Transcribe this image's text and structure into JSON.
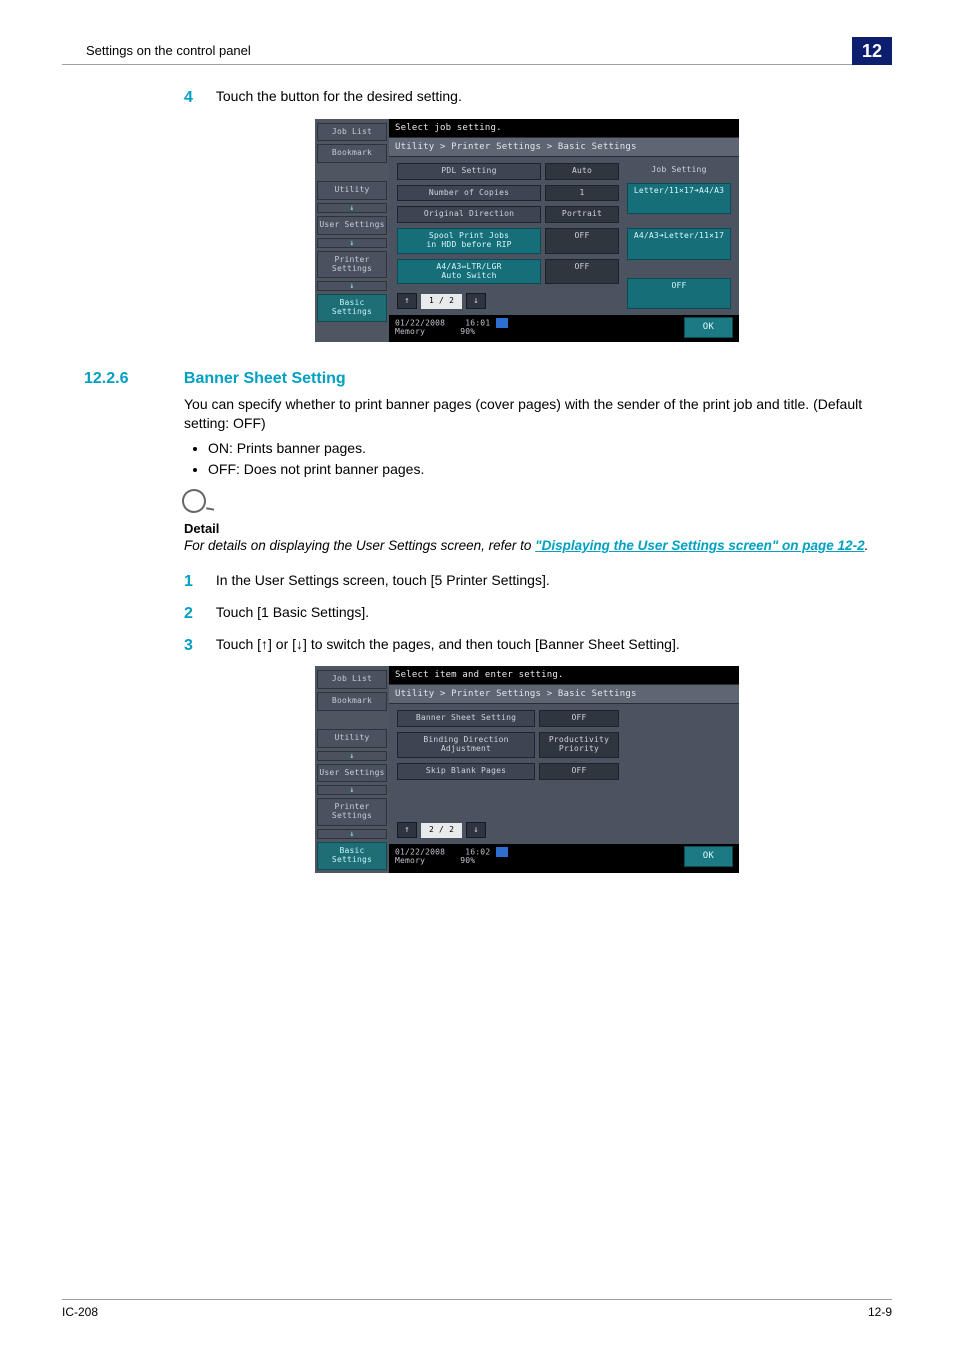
{
  "header": {
    "running_title": "Settings on the control panel",
    "chapter_number": "12"
  },
  "step4": {
    "num": "4",
    "text": "Touch the button for the desired setting."
  },
  "screenshot1": {
    "left": {
      "job_list": "Job List",
      "bookmark": "Bookmark",
      "utility": "Utility",
      "user_settings": "User Settings",
      "printer_settings": "Printer Settings",
      "basic_settings": "Basic Settings"
    },
    "top_msg": "Select job setting.",
    "crumb": "Utility > Printer Settings > Basic Settings",
    "rows": [
      {
        "label": "PDL Setting",
        "value": "Auto"
      },
      {
        "label": "Number of Copies",
        "value": "1"
      },
      {
        "label": "Original Direction",
        "value": "Portrait"
      },
      {
        "label": "Spool Print Jobs\nin HDD before RIP",
        "value": "OFF"
      },
      {
        "label": "A4/A3⇔LTR/LGR\nAuto Switch",
        "value": "OFF"
      }
    ],
    "rightcol": {
      "head": "Job Setting",
      "r1": "Letter/11×17➜A4/A3",
      "r2": "A4/A3➜Letter/11×17",
      "r3": "OFF"
    },
    "pager": "1 / 2",
    "status": {
      "date": "01/22/2008",
      "time": "16:01",
      "mem": "Memory",
      "mempct": "90%"
    },
    "ok": "OK"
  },
  "section": {
    "num": "12.2.6",
    "title": "Banner Sheet Setting",
    "intro": "You can specify whether to print banner pages (cover pages) with the sender of the print job and title. (Default setting: OFF)",
    "b1": "ON: Prints banner pages.",
    "b2": "OFF: Does not print banner pages."
  },
  "note": {
    "label": "Detail",
    "body_pre": "For details on displaying the User Settings screen, refer to ",
    "link": "\"Displaying the User Settings screen\" on page 12-2",
    "body_post": "."
  },
  "step1": {
    "num": "1",
    "text": "In the User Settings screen, touch [5 Printer Settings]."
  },
  "step2": {
    "num": "2",
    "text": "Touch [1 Basic Settings]."
  },
  "step3": {
    "num": "3",
    "text": "Touch [↑] or [↓] to switch the pages, and then touch [Banner Sheet Setting]."
  },
  "screenshot2": {
    "left": {
      "job_list": "Job List",
      "bookmark": "Bookmark",
      "utility": "Utility",
      "user_settings": "User Settings",
      "printer_settings": "Printer Settings",
      "basic_settings": "Basic Settings"
    },
    "top_msg": "Select item and enter setting.",
    "crumb": "Utility > Printer Settings > Basic Settings",
    "rows": [
      {
        "label": "Banner Sheet Setting",
        "value": "OFF"
      },
      {
        "label": "Binding Direction Adjustment",
        "value": "Productivity\nPriority"
      },
      {
        "label": "Skip Blank Pages",
        "value": "OFF"
      }
    ],
    "pager": "2 / 2",
    "status": {
      "date": "01/22/2008",
      "time": "16:02",
      "mem": "Memory",
      "mempct": "90%"
    },
    "ok": "OK"
  },
  "footer": {
    "left": "IC-208",
    "right": "12-9"
  }
}
